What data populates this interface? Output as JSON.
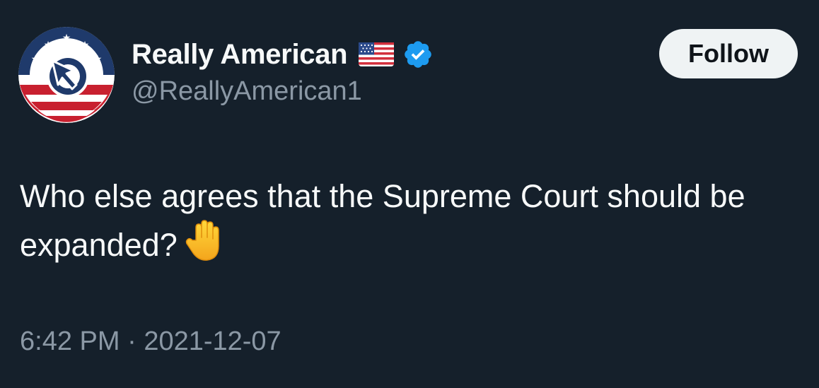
{
  "author": {
    "display_name": "Really American",
    "handle": "@ReallyAmerican1",
    "flag_icon": "us-flag-emoji",
    "verified_icon": "verified-badge-icon",
    "verified_color": "#1d9bf0"
  },
  "follow_button": {
    "label": "Follow"
  },
  "tweet": {
    "text": "Who else agrees that the Supreme Court should be expanded?",
    "emoji_icon": "raised-hand-emoji"
  },
  "meta": {
    "time": "6:42 PM",
    "separator": "·",
    "date": "2021-12-07"
  },
  "colors": {
    "background": "#15202b",
    "text": "#f7f9f9",
    "secondary_text": "#8b98a5",
    "button_bg": "#eff3f4",
    "logo_red": "#c8202f",
    "logo_navy": "#1f3a6b"
  }
}
